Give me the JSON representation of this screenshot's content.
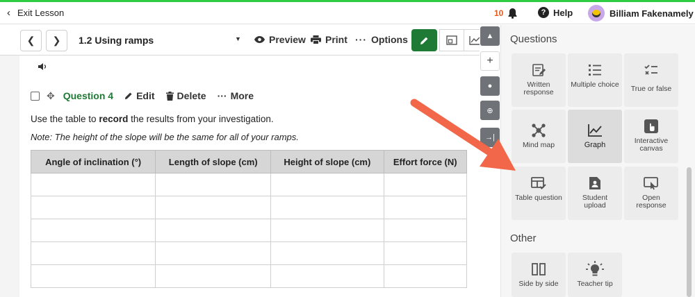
{
  "topbar": {
    "exit_label": "Exit Lesson",
    "notification_count": "10",
    "help_label": "Help",
    "user_name": "Billiam Fakenamely"
  },
  "lesson": {
    "title": "1.2 Using ramps",
    "preview_label": "Preview",
    "print_label": "Print",
    "options_label": "Options"
  },
  "question": {
    "label": "Question 4",
    "edit_label": "Edit",
    "delete_label": "Delete",
    "more_label": "More",
    "prompt_before": "Use the table to ",
    "prompt_bold": "record",
    "prompt_after": " the results from your investigation.",
    "note": "Note: The height of the slope will be the same for all of your ramps."
  },
  "table": {
    "headers": [
      "Angle of inclination (°)",
      "Length of slope (cm)",
      "Height of slope (cm)",
      "Effort force (N)"
    ],
    "rows": [
      [
        "",
        "",
        "",
        ""
      ],
      [
        "",
        "",
        "",
        ""
      ],
      [
        "",
        "",
        "",
        ""
      ],
      [
        "",
        "",
        "",
        ""
      ],
      [
        "",
        "",
        "",
        ""
      ]
    ]
  },
  "panel": {
    "questions_title": "Questions",
    "other_title": "Other",
    "tiles": [
      {
        "label": "Written response",
        "icon": "written-response-icon"
      },
      {
        "label": "Multiple choice",
        "icon": "multiple-choice-icon"
      },
      {
        "label": "True or false",
        "icon": "true-false-icon"
      },
      {
        "label": "Mind map",
        "icon": "mind-map-icon"
      },
      {
        "label": "Graph",
        "icon": "graph-icon"
      },
      {
        "label": "Interactive canvas",
        "icon": "interactive-canvas-icon"
      },
      {
        "label": "Table question",
        "icon": "table-question-icon"
      },
      {
        "label": "Student upload",
        "icon": "student-upload-icon"
      },
      {
        "label": "Open response",
        "icon": "open-response-icon"
      }
    ],
    "other_tiles": [
      {
        "label": "Side by side",
        "icon": "side-by-side-icon"
      },
      {
        "label": "Teacher tip",
        "icon": "teacher-tip-icon"
      }
    ]
  },
  "colors": {
    "accent_green": "#1e7a34",
    "top_line": "#2ecc40",
    "notification": "#e05a1c",
    "arrow": "#f26749"
  }
}
